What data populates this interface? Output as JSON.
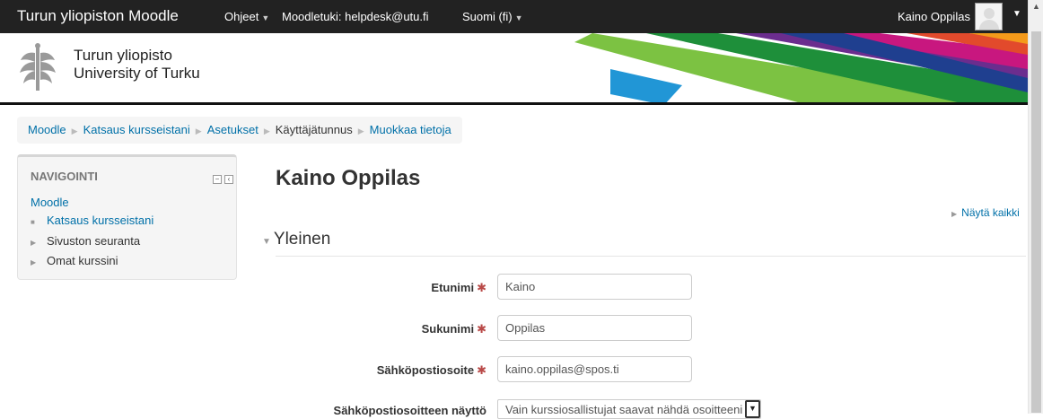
{
  "navbar": {
    "brand": "Turun yliopiston Moodle",
    "menu": [
      {
        "label": "Ohjeet",
        "dropdown": true
      },
      {
        "label": "Moodletuki: helpdesk@utu.fi",
        "dropdown": false
      },
      {
        "label": "Suomi (fi)",
        "dropdown": true
      }
    ],
    "user_name": "Kaino Oppilas"
  },
  "header": {
    "logo_line1": "Turun yliopisto",
    "logo_line2": "University of Turku",
    "stripe_colors": [
      "#2196d6",
      "#7cc242",
      "#1e8f3a",
      "#6b2d8e",
      "#c8177f",
      "#e24a2c",
      "#f49a1a",
      "#1f3f8f"
    ]
  },
  "breadcrumb": {
    "items": [
      {
        "label": "Moodle",
        "link": true
      },
      {
        "label": "Katsaus kursseistani",
        "link": true
      },
      {
        "label": "Asetukset",
        "link": true
      },
      {
        "label": "Käyttäjätunnus",
        "link": false
      },
      {
        "label": "Muokkaa tietoja",
        "link": true
      }
    ]
  },
  "navigation": {
    "title": "NAVIGOINTI",
    "root": "Moodle",
    "items": [
      {
        "label": "Katsaus kursseistani",
        "link": true
      },
      {
        "label": "Sivuston seuranta",
        "link": false
      },
      {
        "label": "Omat kurssini",
        "link": false
      }
    ]
  },
  "main": {
    "title": "Kaino Oppilas",
    "show_all": "Näytä kaikki",
    "section": "Yleinen",
    "fields": [
      {
        "label": "Etunimi",
        "required": true,
        "value": "Kaino"
      },
      {
        "label": "Sukunimi",
        "required": true,
        "value": "Oppilas"
      },
      {
        "label": "Sähköpostiosoite",
        "required": true,
        "value": "kaino.oppilas@spos.ti"
      },
      {
        "label": "Sähköpostiosoitteen näyttö",
        "required": false,
        "value": "Vain kurssiosallistujat saavat nähdä osoitteeni"
      }
    ]
  },
  "colors": {
    "link": "#0070a8",
    "navbar_bg": "#222222",
    "required": "#b94a48"
  }
}
